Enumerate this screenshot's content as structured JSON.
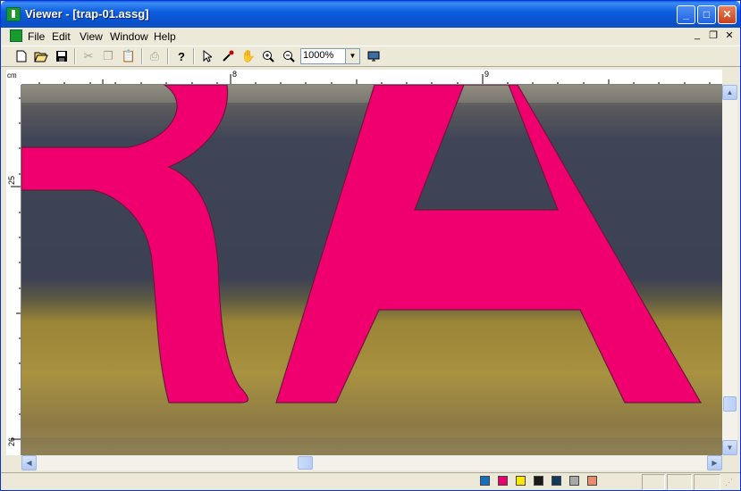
{
  "window": {
    "title": "Viewer - [trap-01.assg]"
  },
  "titlebar_buttons": {
    "minimize": "_",
    "maximize": "□",
    "close": "✕"
  },
  "menu": {
    "file": "File",
    "edit": "Edit",
    "view": "View",
    "window": "Window",
    "help": "Help"
  },
  "mdi_controls": {
    "minimize": "_",
    "restore": "❐",
    "close": "✕"
  },
  "toolbar": {
    "zoom_value": "1000%",
    "icons": [
      "new-icon",
      "open-icon",
      "save-icon",
      "cut-icon",
      "copy-icon",
      "paste-icon",
      "print-icon",
      "help-icon",
      "pointer-icon",
      "eyedropper-icon",
      "hand-icon",
      "zoom-in-icon",
      "zoom-out-icon",
      "monitor-icon"
    ]
  },
  "ruler": {
    "unit": "cm",
    "h_labels": [
      "8",
      "9"
    ],
    "v_labels": [
      "25",
      "26"
    ]
  },
  "canvas": {
    "letters": "RA",
    "glyph_color": "#f0006e",
    "sky_color": "#3c4256",
    "grass_color": "#a08c3c"
  },
  "statusbar": {
    "swatches": [
      "#1470bc",
      "#e8006e",
      "#f8e800",
      "#1a1a1a",
      "#123a5a",
      "#a8a8a8",
      "#e88c6c"
    ]
  }
}
